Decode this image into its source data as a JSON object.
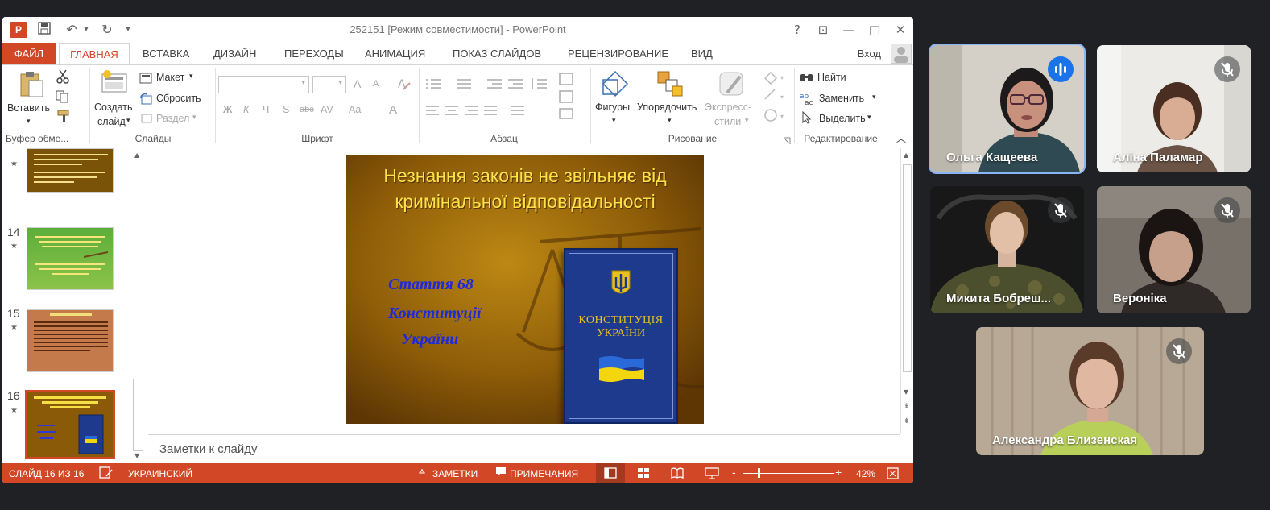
{
  "window": {
    "title": "252151 [Режим совместимости] - PowerPoint",
    "app_icon": "P",
    "signin": "Вход"
  },
  "tabs": [
    "ФАЙЛ",
    "ГЛАВНАЯ",
    "ВСТАВКА",
    "ДИЗАЙН",
    "ПЕРЕХОДЫ",
    "АНИМАЦИЯ",
    "ПОКАЗ СЛАЙДОВ",
    "РЕЦЕНЗИРОВАНИЕ",
    "ВИД"
  ],
  "ribbon": {
    "paste": "Вставить",
    "clipboard_group": "Буфер обме...",
    "new_slide_1": "Создать",
    "new_slide_2": "слайд",
    "layout": "Макет",
    "reset": "Сбросить",
    "section": "Раздел",
    "slides_group": "Слайды",
    "font_group": "Шрифт",
    "bold": "Ж",
    "italic": "К",
    "underline": "Ч",
    "shadow": "S",
    "strike": "abc",
    "spacing": "AV",
    "case": "Aa",
    "font_color": "A",
    "grow": "A",
    "shrink": "A",
    "paragraph_group": "Абзац",
    "shapes": "Фигуры",
    "arrange": "Упорядочить",
    "quick_styles_1": "Экспресс-",
    "quick_styles_2": "стили",
    "drawing_group": "Рисование",
    "find": "Найти",
    "replace": "Заменить",
    "select": "Выделить",
    "editing_group": "Редактирование"
  },
  "thumbnails": [
    {
      "num": "",
      "caption_a": "",
      "caption_b": ""
    },
    {
      "num": "14",
      "caption_a": "",
      "caption_b": ""
    },
    {
      "num": "15",
      "caption_a": "",
      "caption_b": ""
    },
    {
      "num": "16",
      "caption_a": "Незнання законів не звільняє від кримінальної відповідальності",
      "caption_b": "Стаття 68 Конституції України"
    }
  ],
  "slide": {
    "title": "Незнання законів не звільняє від кримінальної відповідальності",
    "article_line1": "Стаття 68",
    "article_line2": "Конституції",
    "article_line3": "України",
    "book_title_1": "КОНСТИТУЦІЯ",
    "book_title_2": "УКРАЇНИ"
  },
  "notes_placeholder": "Заметки к слайду",
  "status": {
    "slide": "СЛАЙД 16 ИЗ 16",
    "language": "УКРАИНСКИЙ",
    "notes": "ЗАМЕТКИ",
    "comments": "ПРИМЕЧАНИЯ",
    "zoom": "42%"
  },
  "participants": [
    {
      "name": "Ольга Кащеева",
      "status": "speaking"
    },
    {
      "name": "Аліна Паламар",
      "status": "muted"
    },
    {
      "name": "Микита Бобреш...",
      "status": "muted"
    },
    {
      "name": "Вероніка",
      "status": "muted"
    },
    {
      "name": "Александра Близенская",
      "status": "muted"
    }
  ],
  "colors": {
    "accent": "#d24726",
    "meet_bg": "#202124",
    "active_outline": "#8ab4f8",
    "slide_title": "#ffe14a",
    "slide_blue_text": "#1e2bd6",
    "book_blue": "#1d3a8c"
  },
  "icons": {
    "mic_muted": "mic-off-icon",
    "speaking": "audio-level-icon"
  }
}
